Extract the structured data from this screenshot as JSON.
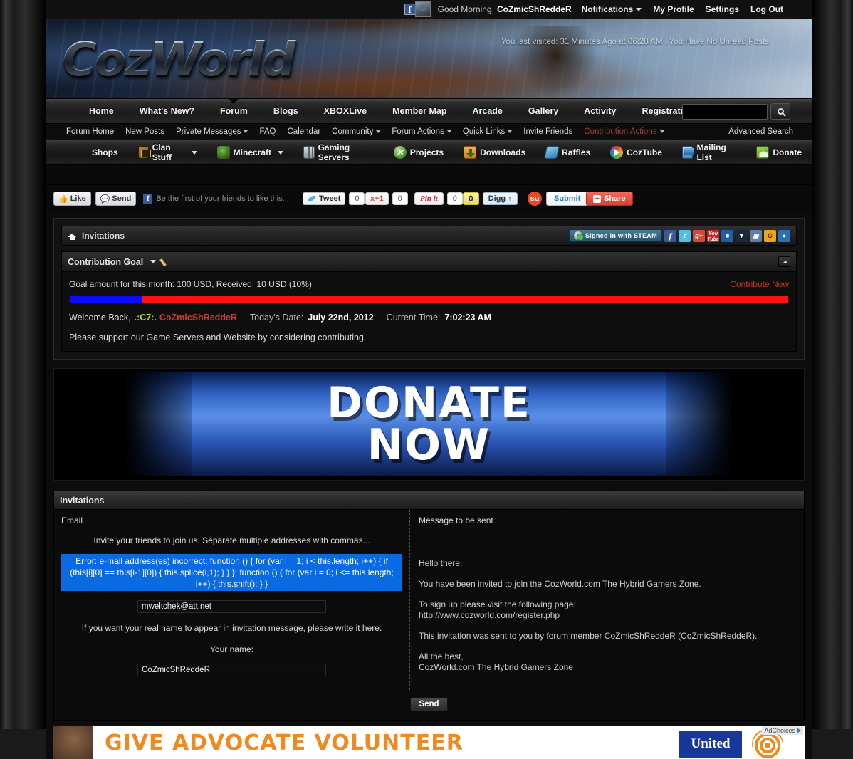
{
  "userbar": {
    "greeting": "Good Morning,",
    "username": "CoZmicShReddeR",
    "links": [
      {
        "label": "Notifications",
        "caret": true
      },
      {
        "label": "My Profile",
        "caret": false
      },
      {
        "label": "Settings",
        "caret": false
      },
      {
        "label": "Log Out",
        "caret": false
      }
    ]
  },
  "banner": {
    "logo_text": "CozWorld",
    "last_visit": "You last visited: 31 Minutes Ago at 06:28 AM . You Have No Unread Posts"
  },
  "nav_main": {
    "items": [
      {
        "label": "Home",
        "active": false
      },
      {
        "label": "What's New?",
        "active": false
      },
      {
        "label": "Forum",
        "active": true
      },
      {
        "label": "Blogs",
        "active": false
      },
      {
        "label": "XBOXLive",
        "active": false
      },
      {
        "label": "Member Map",
        "active": false
      },
      {
        "label": "Arcade",
        "active": false
      },
      {
        "label": "Gallery",
        "active": false
      },
      {
        "label": "Activity",
        "active": false
      },
      {
        "label": "Registration Stats",
        "active": false
      }
    ],
    "search_value": "",
    "search_placeholder": ""
  },
  "nav_sub": {
    "items": [
      {
        "label": "Forum Home",
        "caret": false,
        "highlight": false
      },
      {
        "label": "New Posts",
        "caret": false,
        "highlight": false
      },
      {
        "label": "Private Messages",
        "caret": true,
        "highlight": false
      },
      {
        "label": "FAQ",
        "caret": false,
        "highlight": false
      },
      {
        "label": "Calendar",
        "caret": false,
        "highlight": false
      },
      {
        "label": "Community",
        "caret": true,
        "highlight": false
      },
      {
        "label": "Forum Actions",
        "caret": true,
        "highlight": false
      },
      {
        "label": "Quick Links",
        "caret": true,
        "highlight": false
      },
      {
        "label": "Invite Friends",
        "caret": false,
        "highlight": false
      },
      {
        "label": "Contribution Actions",
        "caret": true,
        "highlight": true
      }
    ],
    "advanced_search": "Advanced Search"
  },
  "nav_icons": {
    "items": [
      {
        "label": "Shops",
        "icon": "",
        "caret": false
      },
      {
        "label": "Clan Stuff",
        "icon": "clan",
        "caret": true
      },
      {
        "label": "Minecraft",
        "icon": "mine",
        "caret": true
      },
      {
        "label": "Gaming Servers",
        "icon": "servers",
        "caret": false
      },
      {
        "label": "Projects",
        "icon": "projects",
        "caret": false
      },
      {
        "label": "Downloads",
        "icon": "dl",
        "caret": false
      },
      {
        "label": "Raffles",
        "icon": "raffle",
        "caret": false
      },
      {
        "label": "CozTube",
        "icon": "coztube",
        "caret": false
      },
      {
        "label": "Mailing List",
        "icon": "mail",
        "caret": false
      },
      {
        "label": "Donate",
        "icon": "donate",
        "caret": false
      }
    ]
  },
  "social": {
    "fb_like": "Like",
    "fb_send": "Send",
    "fb_text": "Be the first of your friends to like this.",
    "tweet_label": "Tweet",
    "tweet_count": "0",
    "gplus_label": "+1",
    "gplus_count": "0",
    "pinit_label": "Pin it",
    "pinit_count": "0",
    "digg_count": "0",
    "digg_label": "Digg",
    "submit_label": "Submit",
    "share_label": "Share"
  },
  "breadcrumb": {
    "title": "Invitations",
    "steam_badge": "Signed in with STEAM"
  },
  "contribution": {
    "panel_title": "Contribution Goal",
    "goal_text": "Goal amount for this month: 100 USD, Received: 10 USD (10%)",
    "contribute_now": "Contribute Now",
    "progress_percent": 10,
    "progress_fill_color": "#0b0bff",
    "progress_track_color": "#ff1212",
    "welcome_prefix": "Welcome Back,",
    "welcome_tag": ".:C7:.",
    "welcome_name": "CoZmicShReddeR",
    "date_label": "Today's Date:",
    "date_value": "July 22nd, 2012",
    "time_label": "Current Time:",
    "time_value": "7:02:23 AM",
    "support_text": "Please support our Game Servers and Website by considering contributing."
  },
  "donate_banner": {
    "line1": "DONATE",
    "line2": "NOW"
  },
  "invitations": {
    "panel_title": "Invitations",
    "email_label": "Email",
    "message_label": "Message to be sent",
    "invite_hint": "Invite your friends to join us. Separate multiple addresses with commas...",
    "error_text": "Error: e-mail address(es) incorrect: function () { for (var i = 1; i < this.length; i++) { if (this[i][0] == this[i-1][0]) { this.splice(i,1); } } }; function () { for (var i = 0; i <= this.length; i++) { this.shift(); } }",
    "email_value": "mweltchek@att.net",
    "realname_hint": "If you want your real name to appear in invitation message, please write it here.",
    "name_label": "Your name:",
    "name_value": "CoZmicShReddeR",
    "message_lines": [
      "Hello there,",
      "You have been invited to join the CozWorld.com The Hybrid Gamers Zone.",
      "To sign up please visit the following page:\nhttp://www.cozworld.com/register.php",
      "This invitation was sent to you by forum member CoZmicShReddeR (CoZmicShReddeR).",
      "All the best,\nCozWorld.com The Hybrid Gamers Zone"
    ],
    "send_button": "Send"
  },
  "ad": {
    "text": "GIVE ADVOCATE VOLUNTEER",
    "brand": "United",
    "adchoices": "AdChoices"
  }
}
